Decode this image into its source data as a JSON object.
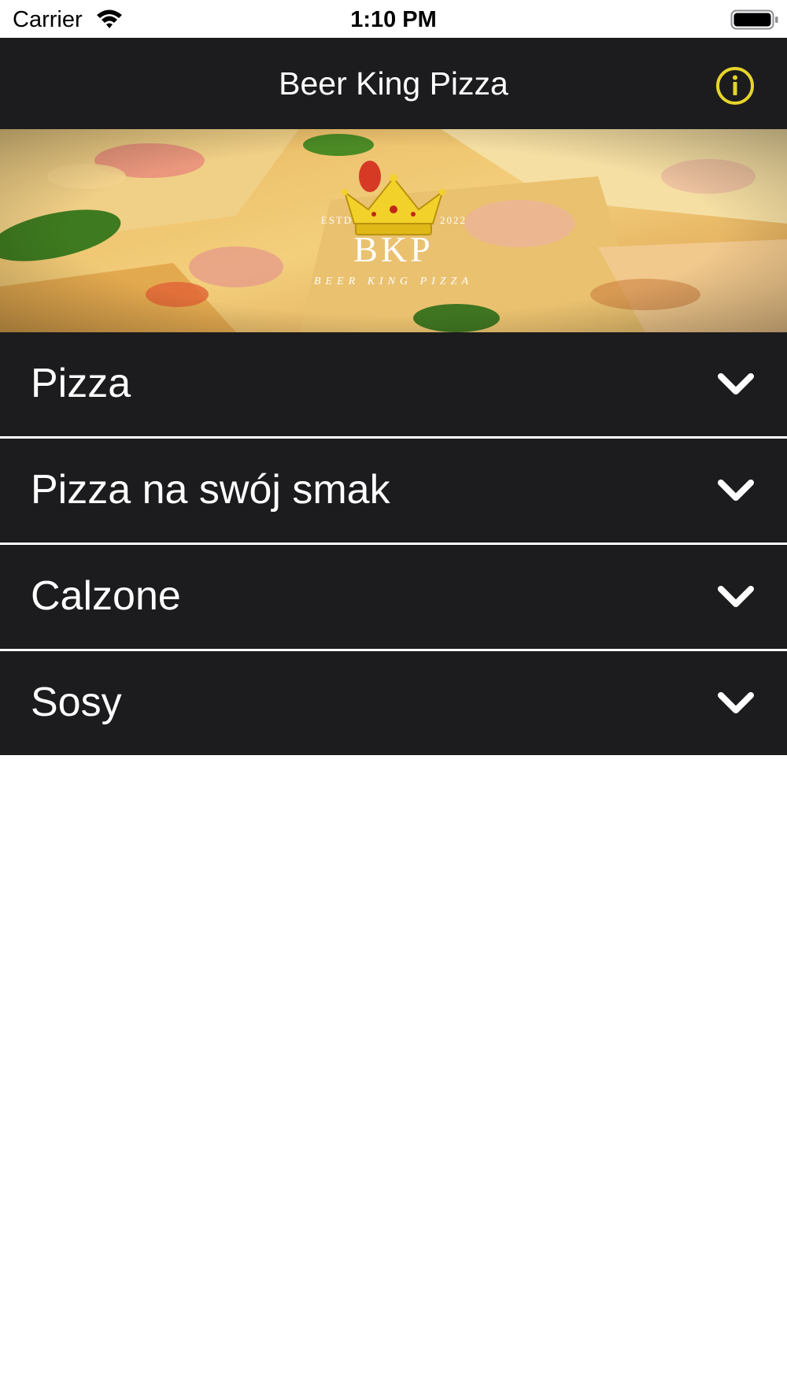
{
  "status_bar": {
    "carrier": "Carrier",
    "time": "1:10 PM",
    "wifi_icon": "wifi-icon",
    "battery_icon": "battery-icon"
  },
  "nav": {
    "title": "Beer King Pizza",
    "info_icon": "info-circle-icon",
    "accent_color": "#e6d42a",
    "background_color": "#1c1c1e"
  },
  "banner": {
    "logo_monogram": "BKP",
    "logo_established": "ESTD",
    "logo_year": "2022",
    "logo_subtitle": "BEER KING PIZZA",
    "logo_icon": "crown-icon"
  },
  "categories": [
    {
      "label": "Pizza",
      "icon": "chevron-down-icon"
    },
    {
      "label": "Pizza na swój smak",
      "icon": "chevron-down-icon"
    },
    {
      "label": "Calzone",
      "icon": "chevron-down-icon"
    },
    {
      "label": "Sosy",
      "icon": "chevron-down-icon"
    }
  ]
}
